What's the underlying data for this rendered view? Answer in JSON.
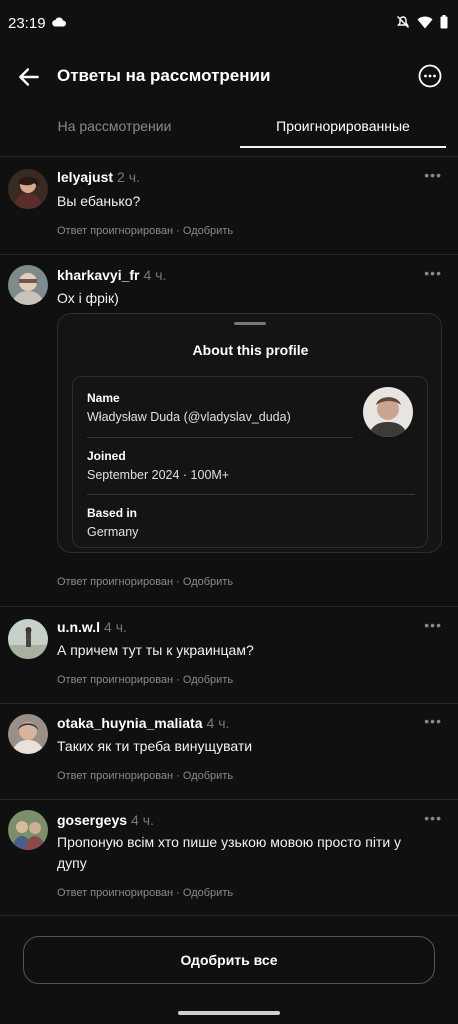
{
  "status_bar": {
    "time": "23:19"
  },
  "header": {
    "title": "Ответы на рассмотрении"
  },
  "tabs": [
    {
      "label": "На рассмотрении",
      "active": false
    },
    {
      "label": "Проигнорированные",
      "active": true
    }
  ],
  "comments": [
    {
      "username": "lelyajust",
      "time": "2 ч.",
      "text": "Вы ебанько?",
      "status": "Ответ проигнорирован",
      "approve": "Одобрить"
    },
    {
      "username": "kharkavyi_fr",
      "time": "4 ч.",
      "text": "Ох і фрік)",
      "status": "Ответ проигнорирован",
      "approve": "Одобрить"
    },
    {
      "username": "u.n.w.l",
      "time": "4 ч.",
      "text": "А причем тут ты к украинцам?",
      "status": "Ответ проигнорирован",
      "approve": "Одобрить"
    },
    {
      "username": "otaka_huynia_maliata",
      "time": "4 ч.",
      "text": "Таких як ти треба винущувати",
      "status": "Ответ проигнорирован",
      "approve": "Одобрить"
    },
    {
      "username": "gosergeys",
      "time": "4 ч.",
      "text": "Пропоную всім хто пише узькою мовою просто піти у дупу",
      "status": "Ответ проигнорирован",
      "approve": "Одобрить"
    }
  ],
  "profile_card": {
    "title": "About this profile",
    "name_label": "Name",
    "name_value": "Władysław Duda (@vladyslav_duda)",
    "joined_label": "Joined",
    "joined_value": "September 2024 · 100M+",
    "based_label": "Based in",
    "based_value": "Germany"
  },
  "footer": {
    "approve_all": "Одобрить все"
  },
  "colors": {
    "background": "#101010",
    "text": "#f5f5f5",
    "muted": "#8a8a8a",
    "divider": "#262626"
  }
}
